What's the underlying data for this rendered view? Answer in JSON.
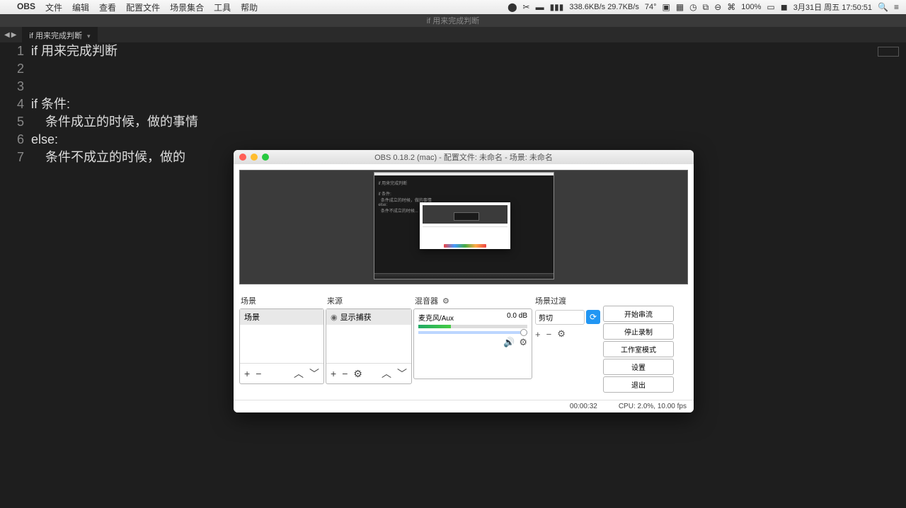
{
  "menubar": {
    "app": "OBS",
    "items": [
      "文件",
      "编辑",
      "查看",
      "配置文件",
      "场景集合",
      "工具",
      "帮助"
    ],
    "right": {
      "temp": "74°",
      "net": "338.6KB/s 29.7KB/s",
      "battery": "100%",
      "date": "3月31日 周五 17:50:51"
    }
  },
  "editor": {
    "tab": "if 用来完成判断",
    "tab_title": "if 用来完成判断",
    "lines": [
      "if 用来完成判断",
      "",
      "",
      "if 条件:",
      "    条件成立的时候，做的事情",
      "else:",
      "    条件不成立的时候，做的"
    ]
  },
  "obs": {
    "title": "OBS 0.18.2 (mac) - 配置文件: 未命名 - 场景: 未命名",
    "panels": {
      "scenes_label": "场景",
      "sources_label": "来源",
      "mixer_label": "混音器",
      "trans_label": "场景过渡",
      "scene_item": "场景",
      "source_item": "显示捕获",
      "mixer_channel": "麦克风/Aux",
      "mixer_db": "0.0 dB",
      "trans_item": "剪切",
      "ctrl": {
        "start_stream": "开始串流",
        "start_record": "停止录制",
        "studio": "工作室模式",
        "settings": "设置",
        "exit": "退出"
      }
    },
    "status": {
      "time": "00:00:32",
      "cpu": "CPU: 2.0%, 10.00 fps"
    }
  }
}
